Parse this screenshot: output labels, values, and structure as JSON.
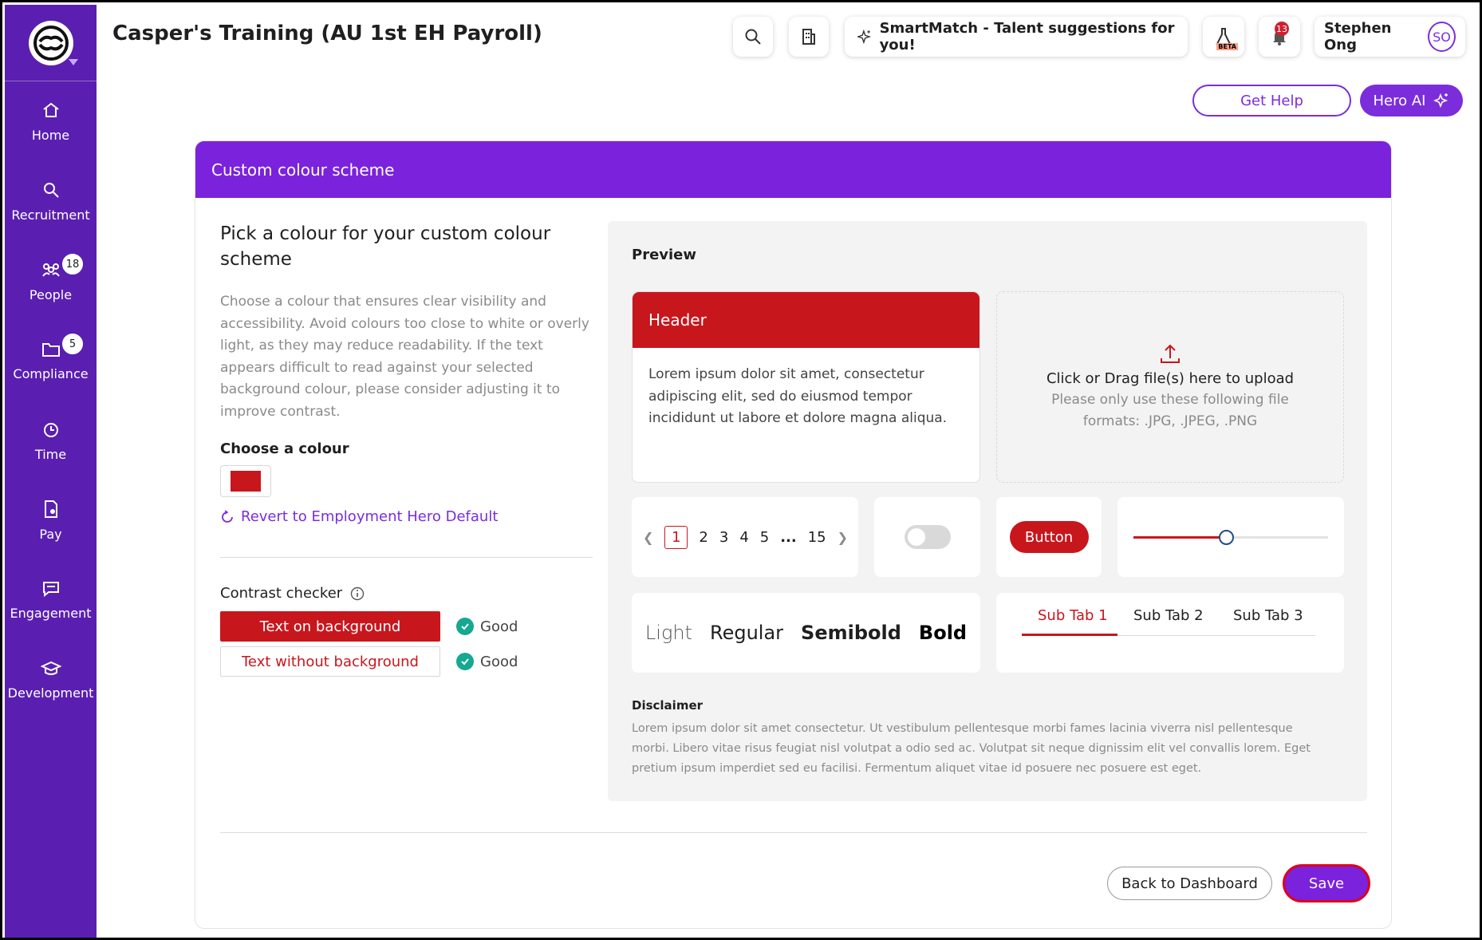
{
  "app": {
    "title": "Casper's Training (AU 1st EH Payroll)"
  },
  "sidebar": {
    "items": [
      {
        "label": "Home",
        "icon": "home-icon"
      },
      {
        "label": "Recruitment",
        "icon": "search-person-icon"
      },
      {
        "label": "People",
        "icon": "people-icon",
        "badge": "18"
      },
      {
        "label": "Compliance",
        "icon": "folder-icon",
        "badge": "5"
      },
      {
        "label": "Time",
        "icon": "time-icon"
      },
      {
        "label": "Pay",
        "icon": "pay-icon"
      },
      {
        "label": "Engagement",
        "icon": "chat-icon"
      },
      {
        "label": "Development",
        "icon": "graduation-cap-icon"
      }
    ]
  },
  "topbar": {
    "smartmatch_label": "SmartMatch - Talent suggestions for you!",
    "beta_label": "BETA",
    "notifications_count": "13",
    "user_name": "Stephen Ong",
    "user_initials": "SO",
    "get_help_label": "Get Help",
    "hero_ai_label": "Hero AI"
  },
  "card": {
    "header_title": "Custom colour scheme",
    "pick_title": "Pick a colour for your custom colour scheme",
    "pick_description": "Choose a colour that ensures clear visibility and accessibility. Avoid colours too close to white or overly light, as they may reduce readability. If the text appears difficult to read against your selected background colour, please consider adjusting it to improve contrast.",
    "choose_label": "Choose a colour",
    "selected_colour": "#c8161d",
    "revert_label": "Revert to Employment Hero Default",
    "contrast_label": "Contrast checker",
    "contrast_rows": [
      {
        "label": "Text on background",
        "result": "Good"
      },
      {
        "label": "Text without background",
        "result": "Good"
      }
    ],
    "back_label": "Back to Dashboard",
    "save_label": "Save"
  },
  "preview": {
    "title": "Preview",
    "header_label": "Header",
    "lorem": "Lorem ipsum dolor sit amet, consectetur adipiscing elit, sed do eiusmod tempor incididunt ut labore et dolore magna aliqua.",
    "upload_main": "Click or Drag file(s) here to upload",
    "upload_sub": "Please only use these following file formats: .JPG, .JPEG, .PNG",
    "pages": [
      "1",
      "2",
      "3",
      "4",
      "5",
      "...",
      "15"
    ],
    "button_label": "Button",
    "slider_value_percent": 48,
    "weights": [
      "Light",
      "Regular",
      "Semibold",
      "Bold"
    ],
    "tabs": [
      "Sub Tab 1",
      "Sub Tab 2",
      "Sub Tab 3"
    ],
    "disclaimer_title": "Disclaimer",
    "disclaimer_text": "Lorem ipsum dolor sit amet consectetur. Ut vestibulum pellentesque morbi fames lacinia viverra nisl pellentesque morbi. Libero vitae risus feugiat nisl volutpat a odio sed ac. Volutpat sit neque dignissim elit vel convallis lorem. Eget pretium ipsum imperdiet sed eu facilisi. Fermentum aliquet vitae id posuere nec posuere est eget."
  },
  "colors": {
    "brand_purple": "#7b22dc",
    "sidebar_purple": "#5a1fb0",
    "accent_red": "#c8161d",
    "good_green": "#16a890"
  }
}
